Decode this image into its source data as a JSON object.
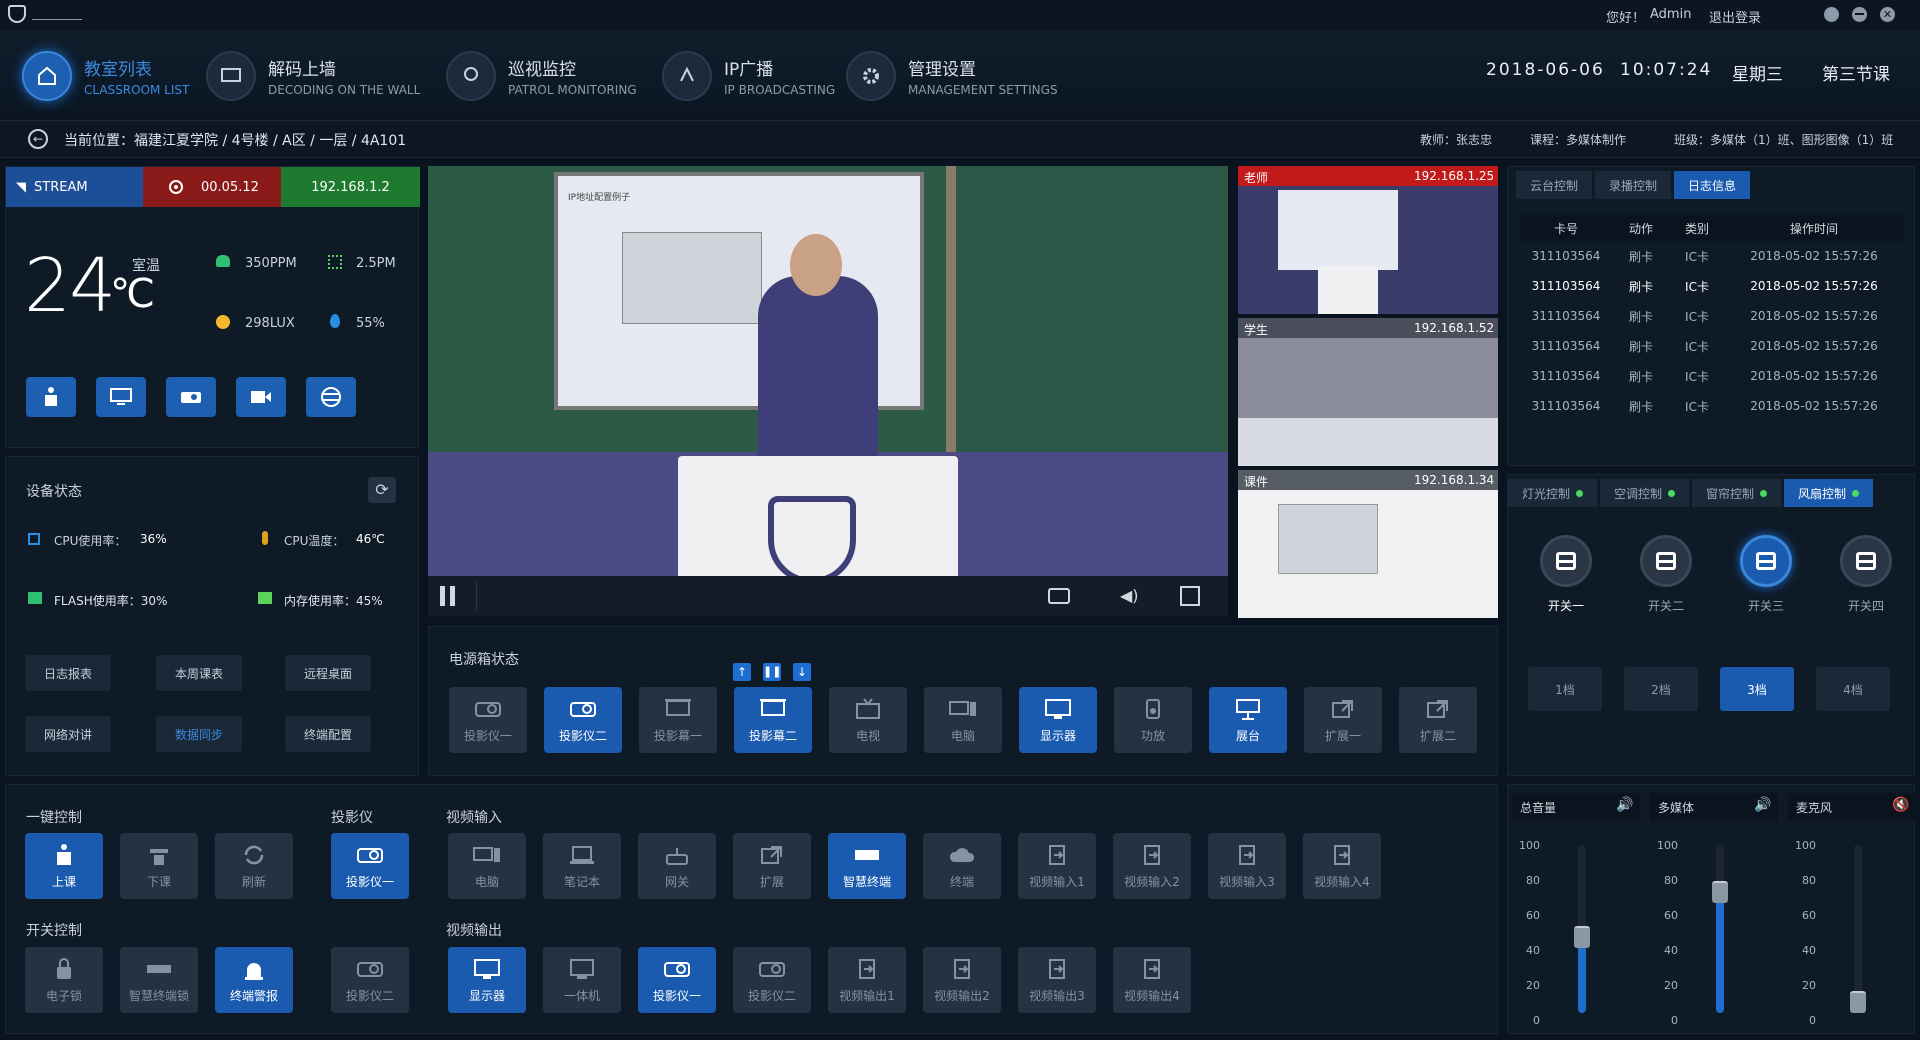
{
  "titlebar": {
    "greeting": "您好！",
    "user": "Admin",
    "logout": "退出登录"
  },
  "nav": [
    {
      "cn": "教室列表",
      "en": "CLASSROOM LIST",
      "icon": "classroom-icon"
    },
    {
      "cn": "解码上墙",
      "en": "DECODING ON THE WALL",
      "icon": "monitor-icon"
    },
    {
      "cn": "巡视监控",
      "en": "PATROL MONITORING",
      "icon": "patrol-icon"
    },
    {
      "cn": "IP广播",
      "en": "IP BROADCASTING",
      "icon": "broadcast-icon"
    },
    {
      "cn": "管理设置",
      "en": "MANAGEMENT SETTINGS",
      "icon": "gear-icon"
    }
  ],
  "datetime": {
    "date": "2018-06-06",
    "time": "10:07:24",
    "weekday": "星期三",
    "period": "第三节课"
  },
  "location": {
    "path": "当前位置：福建江夏学院 / 4号楼 / A区 / 一层 / 4A101",
    "teacher": "教师：张志忠",
    "course": "课程：多媒体制作",
    "class": "班级：多媒体（1）班、图形图像（1）班"
  },
  "stream": {
    "label": "STREAM",
    "timer": "00.05.12",
    "ip": "192.168.1.2"
  },
  "env": {
    "temp": "24",
    "unit": "℃",
    "temp_label": "室温",
    "co2": "350PPM",
    "pm": "2.5PM",
    "lux": "298LUX",
    "humidity": "55%"
  },
  "device_status": {
    "title": "设备状态",
    "cpu": "CPU使用率：",
    "cpu_val": "36%",
    "cpu_temp": "CPU温度：",
    "cpu_temp_val": "46℃",
    "flash": "FLASH使用率：30%",
    "mem": "内存使用率：45%"
  },
  "tools": [
    "日志报表",
    "本周课表",
    "远程桌面",
    "网络对讲",
    "数据同步",
    "终端配置"
  ],
  "cams": [
    {
      "label": "老师",
      "ip": "192.168.1.25"
    },
    {
      "label": "学生",
      "ip": "192.168.1.52"
    },
    {
      "label": "课件",
      "ip": "192.168.1.34"
    }
  ],
  "screen_title": "IP地址配置例子",
  "power": {
    "title": "电源箱状态",
    "items": [
      "投影仪一",
      "投影仪二",
      "投影幕一",
      "投影幕二",
      "电视",
      "电脑",
      "显示器",
      "功放",
      "展台",
      "扩展一",
      "扩展二"
    ]
  },
  "right_tabs": [
    "云台控制",
    "录播控制",
    "日志信息"
  ],
  "log": {
    "headers": [
      "卡号",
      "动作",
      "类别",
      "操作时间"
    ],
    "rows": [
      [
        "311103564",
        "刷卡",
        "IC卡",
        "2018-05-02  15:57:26"
      ],
      [
        "311103564",
        "刷卡",
        "IC卡",
        "2018-05-02  15:57:26"
      ],
      [
        "311103564",
        "刷卡",
        "IC卡",
        "2018-05-02  15:57:26"
      ],
      [
        "311103564",
        "刷卡",
        "IC卡",
        "2018-05-02  15:57:26"
      ],
      [
        "311103564",
        "刷卡",
        "IC卡",
        "2018-05-02  15:57:26"
      ],
      [
        "311103564",
        "刷卡",
        "IC卡",
        "2018-05-02  15:57:26"
      ]
    ]
  },
  "ctrl_tabs": [
    "灯光控制",
    "空调控制",
    "窗帘控制",
    "风扇控制"
  ],
  "switches": [
    "开关一",
    "开关二",
    "开关三",
    "开关四"
  ],
  "levels": [
    "1档",
    "2档",
    "3档",
    "4档"
  ],
  "onekey": {
    "title": "一键控制",
    "items": [
      "上课",
      "下课",
      "刷新"
    ]
  },
  "switchctrl": {
    "title": "开关控制",
    "items": [
      "电子锁",
      "智慧终端锁",
      "终端警报"
    ]
  },
  "projector": {
    "title": "投影仪",
    "items": [
      "投影仪一",
      "投影仪二"
    ]
  },
  "vin": {
    "title": "视频输入",
    "items": [
      "电脑",
      "笔记本",
      "网关",
      "扩展",
      "智慧终端",
      "终端",
      "视频输入1",
      "视频输入2",
      "视频输入3",
      "视频输入4"
    ]
  },
  "vout": {
    "title": "视频输出",
    "items": [
      "显示器",
      "一体机",
      "投影仪一",
      "投影仪二",
      "视频输出1",
      "视频输出2",
      "视频输出3",
      "视频输出4"
    ]
  },
  "volume": [
    {
      "label": "总音量",
      "level": 0.45
    },
    {
      "label": "多媒体",
      "level": 0.72
    },
    {
      "label": "麦克风",
      "level": 0.0
    }
  ],
  "scale": [
    "100",
    "80",
    "60",
    "40",
    "20",
    "0"
  ],
  "colors": {
    "accent": "#1a5bb0",
    "stream_bg": "#1d4f99",
    "rec_bg": "#8b1a1a",
    "ip_bg": "#1e7a2e"
  }
}
